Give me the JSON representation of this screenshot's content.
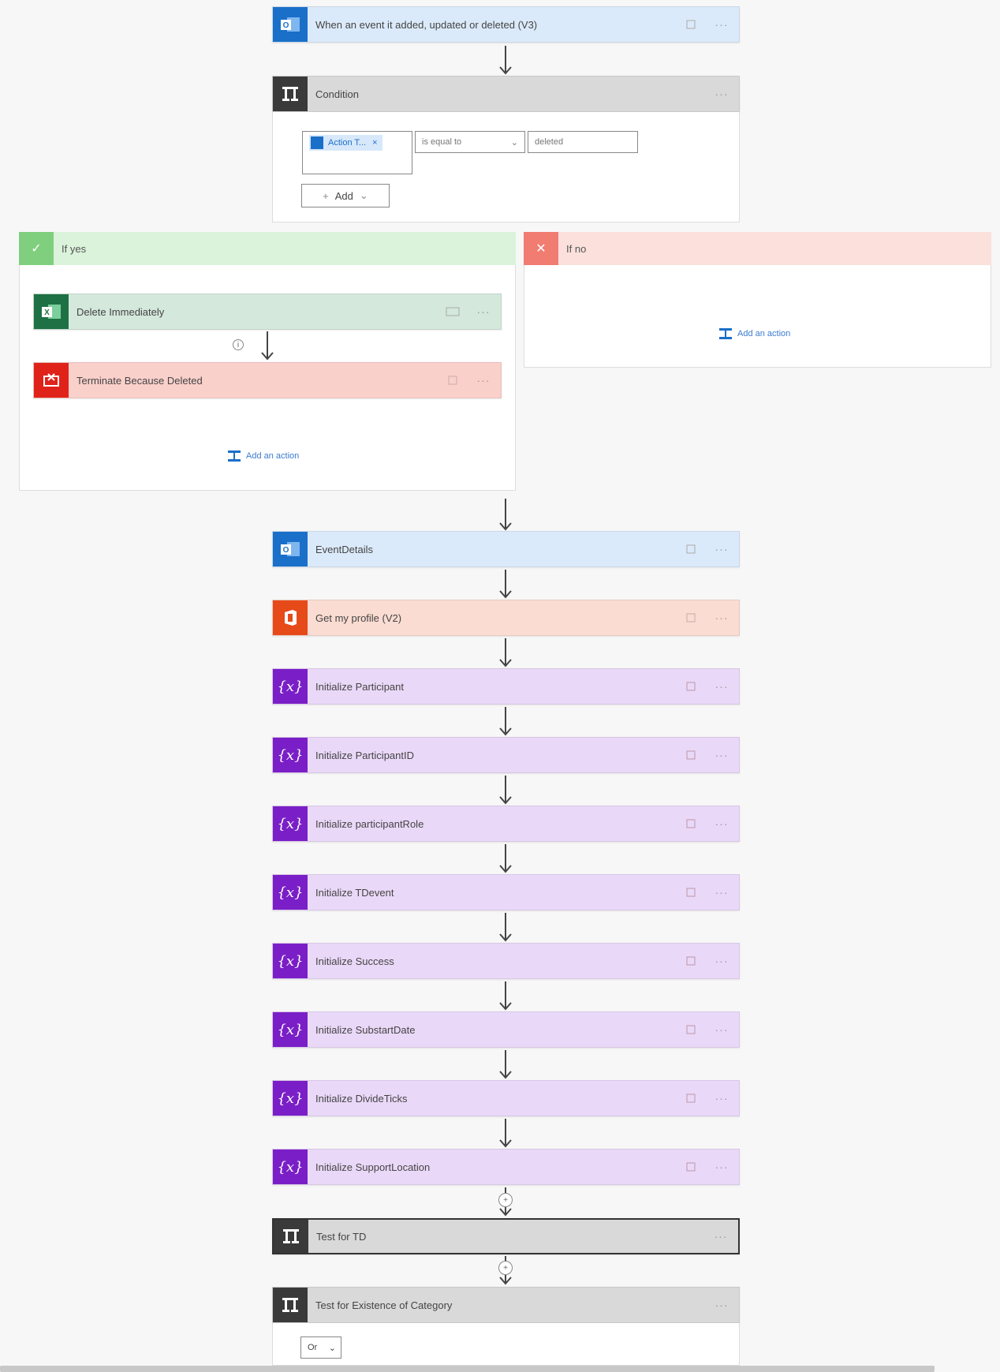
{
  "trigger": {
    "label": "When an event it added, updated or deleted (V3)",
    "icon": "outlook-icon",
    "more": "···"
  },
  "condition": {
    "label": "Condition",
    "left_token": "Action T...",
    "operator": "is equal to",
    "value": "deleted",
    "add_label": "Add",
    "more": "···"
  },
  "if_yes": {
    "label": "If yes",
    "steps": [
      {
        "label": "Delete Immediately",
        "icon": "excel-icon"
      },
      {
        "label": "Terminate Because Deleted",
        "icon": "terminate-icon"
      }
    ],
    "add_action": "Add an action"
  },
  "if_no": {
    "label": "If no",
    "add_action": "Add an action"
  },
  "steps": [
    {
      "label": "EventDetails",
      "kind": "outlook"
    },
    {
      "label": "Get my profile (V2)",
      "kind": "office"
    },
    {
      "label": "Initialize Participant",
      "kind": "var"
    },
    {
      "label": "Initialize ParticipantID",
      "kind": "var"
    },
    {
      "label": "Initialize participantRole",
      "kind": "var"
    },
    {
      "label": "Initialize TDevent",
      "kind": "var"
    },
    {
      "label": "Initialize Success",
      "kind": "var"
    },
    {
      "label": "Initialize SubstartDate",
      "kind": "var"
    },
    {
      "label": "Initialize DivideTicks",
      "kind": "var"
    },
    {
      "label": "Initialize SupportLocation",
      "kind": "var"
    }
  ],
  "test_td": {
    "label": "Test for TD"
  },
  "test_category": {
    "label": "Test for Existence of Category",
    "or_label": "Or"
  },
  "icons": {
    "variable_glyph": "{x}",
    "more_glyph": "···"
  },
  "colors": {
    "outlook": "#1a6fc9",
    "condition": "#3a3a3a",
    "office": "#e64a19",
    "variable": "#7a1fc7",
    "excel": "#1e7145",
    "terminate": "#e0231a",
    "yes_green": "#7fcf7f",
    "no_red": "#f07c72"
  }
}
